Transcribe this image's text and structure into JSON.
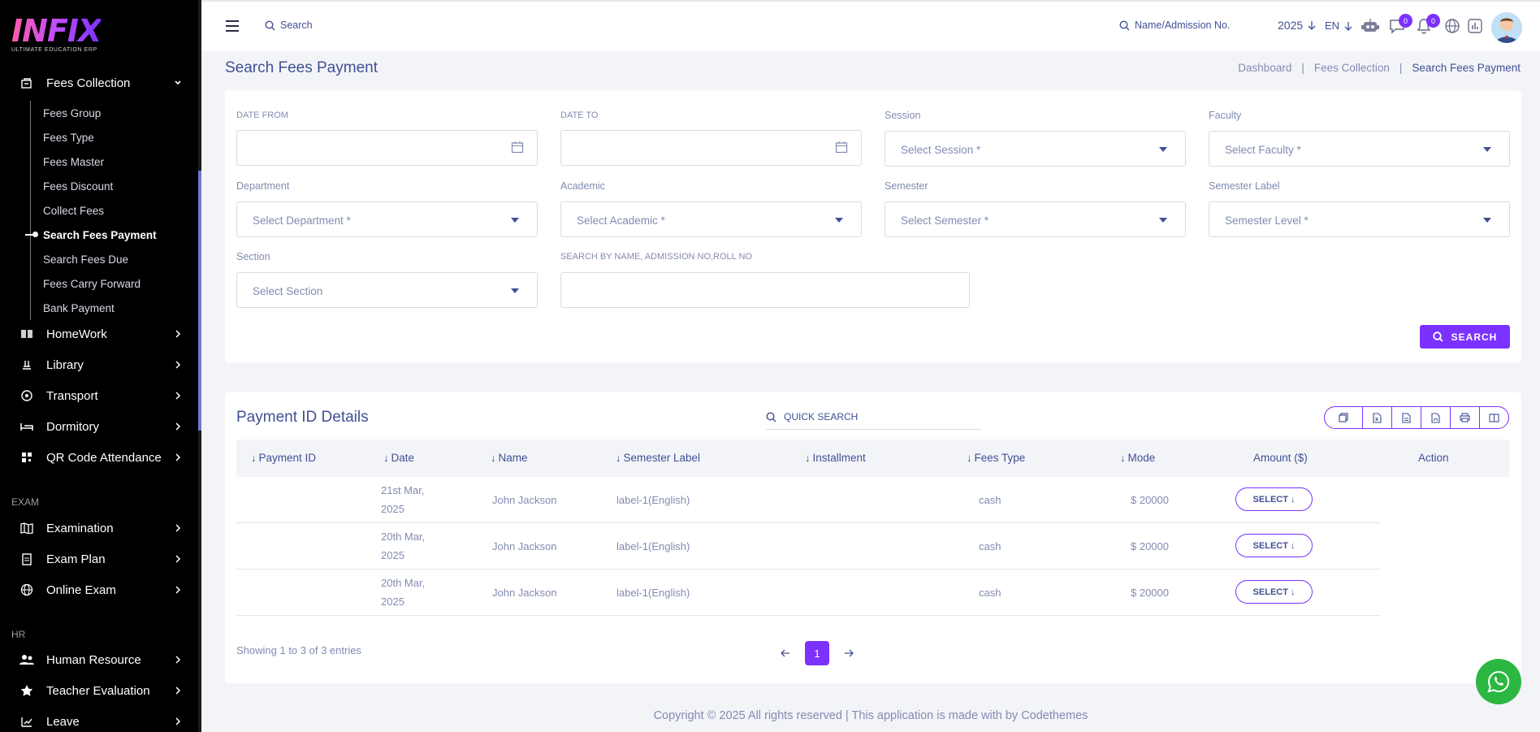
{
  "brand": {
    "logo_text": "INFIX",
    "logo_sub": "ULTIMATE EDUCATION ERP"
  },
  "sidebar": {
    "open_group": {
      "label": "Fees Collection",
      "icon": "fees-icon"
    },
    "sub_items": [
      {
        "label": "Fees Group",
        "active": false
      },
      {
        "label": "Fees Type",
        "active": false
      },
      {
        "label": "Fees Master",
        "active": false
      },
      {
        "label": "Fees Discount",
        "active": false
      },
      {
        "label": "Collect Fees",
        "active": false
      },
      {
        "label": "Search Fees Payment",
        "active": true
      },
      {
        "label": "Search Fees Due",
        "active": false
      },
      {
        "label": "Fees Carry Forward",
        "active": false
      },
      {
        "label": "Bank Payment",
        "active": false
      }
    ],
    "menu_a": [
      {
        "label": "HomeWork",
        "icon": "book-icon"
      },
      {
        "label": "Library",
        "icon": "library-icon"
      },
      {
        "label": "Transport",
        "icon": "transport-icon"
      },
      {
        "label": "Dormitory",
        "icon": "bed-icon"
      },
      {
        "label": "QR Code Attendance",
        "icon": "qr-icon"
      }
    ],
    "section_exam": "EXAM",
    "menu_exam": [
      {
        "label": "Examination",
        "icon": "map-icon"
      },
      {
        "label": "Exam Plan",
        "icon": "clipboard-icon"
      },
      {
        "label": "Online Exam",
        "icon": "globe-icon"
      }
    ],
    "section_hr": "HR",
    "menu_hr": [
      {
        "label": "Human Resource",
        "icon": "people-icon"
      },
      {
        "label": "Teacher Evaluation",
        "icon": "star-icon"
      },
      {
        "label": "Leave",
        "icon": "leave-icon"
      }
    ]
  },
  "topbar": {
    "search_label": "Search",
    "name_search_label": "Name/Admission No.",
    "year": "2025",
    "language": "EN",
    "chat_count": "0",
    "notification_count": "0"
  },
  "page": {
    "title": "Search Fees Payment",
    "breadcrumb": [
      "Dashboard",
      "Fees Collection",
      "Search Fees Payment"
    ]
  },
  "filters": {
    "date_from_label": "DATE FROM",
    "date_to_label": "DATE TO",
    "session_label": "Session",
    "session_placeholder": "Select Session *",
    "faculty_label": "Faculty",
    "faculty_placeholder": "Select Faculty *",
    "department_label": "Department",
    "department_placeholder": "Select Department *",
    "academic_label": "Academic",
    "academic_placeholder": "Select Academic *",
    "semester_label": "Semester",
    "semester_placeholder": "Select Semester *",
    "semester_level_label": "Semester Label",
    "semester_level_placeholder": "Semester Level *",
    "section_label": "Section",
    "section_placeholder": "Select Section",
    "keyword_label": "SEARCH BY NAME, ADMISSION NO,ROLL NO",
    "search_button": "SEARCH"
  },
  "table": {
    "title": "Payment ID Details",
    "quick_search": "QUICK SEARCH",
    "export_icons": [
      "copy-icon",
      "excel-icon",
      "csv-icon",
      "pdf-icon",
      "print-icon",
      "columns-icon"
    ],
    "columns": [
      "Payment ID",
      "Date",
      "Name",
      "Semester Label",
      "Installment",
      "Fees Type",
      "Mode",
      "Amount ($)",
      "Action"
    ],
    "rows": [
      {
        "payment_id": "",
        "date_line1": "21st Mar,",
        "date_line2": "2025",
        "name": "John Jackson",
        "semester_label": "label-1(English)",
        "installment": "",
        "fees_type": "cash",
        "amount": "$ 20000",
        "action": "SELECT"
      },
      {
        "payment_id": "",
        "date_line1": "20th Mar,",
        "date_line2": "2025",
        "name": "John Jackson",
        "semester_label": "label-1(English)",
        "installment": "",
        "fees_type": "cash",
        "amount": "$ 20000",
        "action": "SELECT"
      },
      {
        "payment_id": "",
        "date_line1": "20th Mar,",
        "date_line2": "2025",
        "name": "John Jackson",
        "semester_label": "label-1(English)",
        "installment": "",
        "fees_type": "cash",
        "amount": "$ 20000",
        "action": "SELECT"
      }
    ],
    "showing": "Showing 1 to 3 of 3 entries",
    "current_page": "1"
  },
  "footer": {
    "text": "Copyright © 2025 All rights reserved | This application is made with by Codethemes"
  },
  "colors": {
    "accent": "#7c32ff",
    "text": "#415094",
    "muted": "#828bb2",
    "sidebar_bg": "#000000",
    "whatsapp": "#2bb741"
  }
}
